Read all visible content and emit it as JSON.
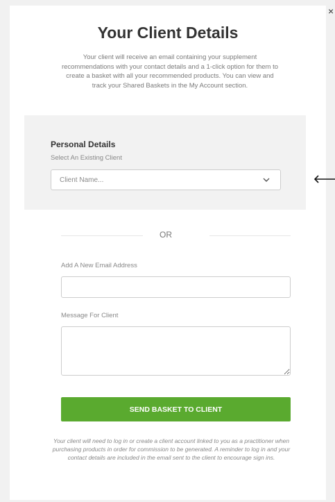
{
  "modal": {
    "close_label": "×",
    "title": "Your Client Details",
    "intro": "Your client will receive an email containing your supplement recommendations with your contact details and a 1-click option for them to create a basket with all your recommended products. You can view and track your Shared Baskets in the My Account section."
  },
  "personal_details": {
    "heading": "Personal Details",
    "select_label": "Select An Existing Client",
    "select_value": "Client Name...",
    "chevron_icon": "chevron-down-icon",
    "arrow_icon": "left-arrow-icon"
  },
  "divider": {
    "or_label": "OR"
  },
  "new_email": {
    "label": "Add A New Email Address",
    "value": "",
    "placeholder": ""
  },
  "message": {
    "label": "Message For Client",
    "value": "",
    "placeholder": ""
  },
  "send_button": {
    "label": "SEND BASKET TO CLIENT",
    "color": "#5aaa2f"
  },
  "footer_note": "Your client will need to log in or create a client account linked to you as a practitioner when purchasing products in order for commission to be generated. A reminder to log in and your contact details are included in the email sent to the client to encourage sign ins."
}
